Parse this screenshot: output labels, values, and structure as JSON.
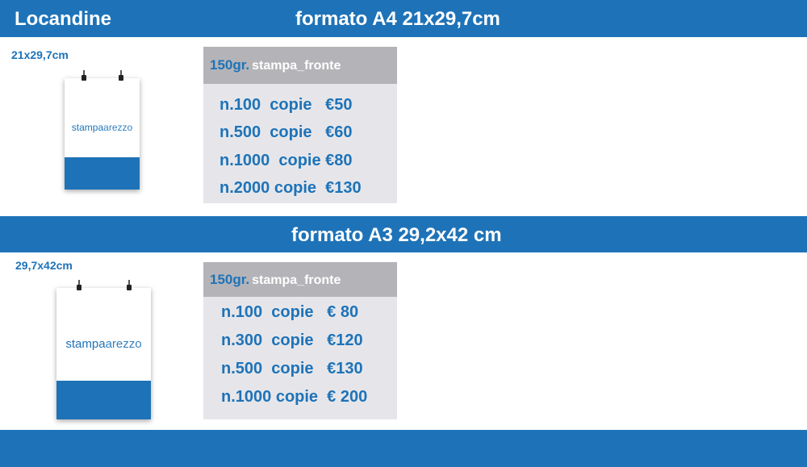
{
  "header": {
    "title": "Locandine",
    "format_a4": "formato A4 21x29,7cm"
  },
  "a4": {
    "size_label": "21x29,7cm",
    "brand_main": "stampa",
    "brand_light": "arezzo",
    "paper": "150gr.",
    "print_type": "stampa_fronte",
    "rows": [
      "n.100  copie   €50",
      "n.500  copie   €60",
      "n.1000  copie €80",
      "n.2000 copie  €130"
    ]
  },
  "a3": {
    "title": "formato A3 29,2x42 cm",
    "size_label": "29,7x42cm",
    "brand_main": "stampa",
    "brand_light": "arezzo",
    "paper": "150gr.",
    "print_type": "stampa_fronte",
    "rows": [
      "n.100  copie   € 80",
      "n.300  copie   €120",
      "n.500  copie   €130",
      "n.1000 copie  € 200"
    ]
  },
  "colors": {
    "brand_blue": "#1e73b8",
    "header_gray": "#b4b4b8",
    "box_gray": "#e6e6ea"
  }
}
